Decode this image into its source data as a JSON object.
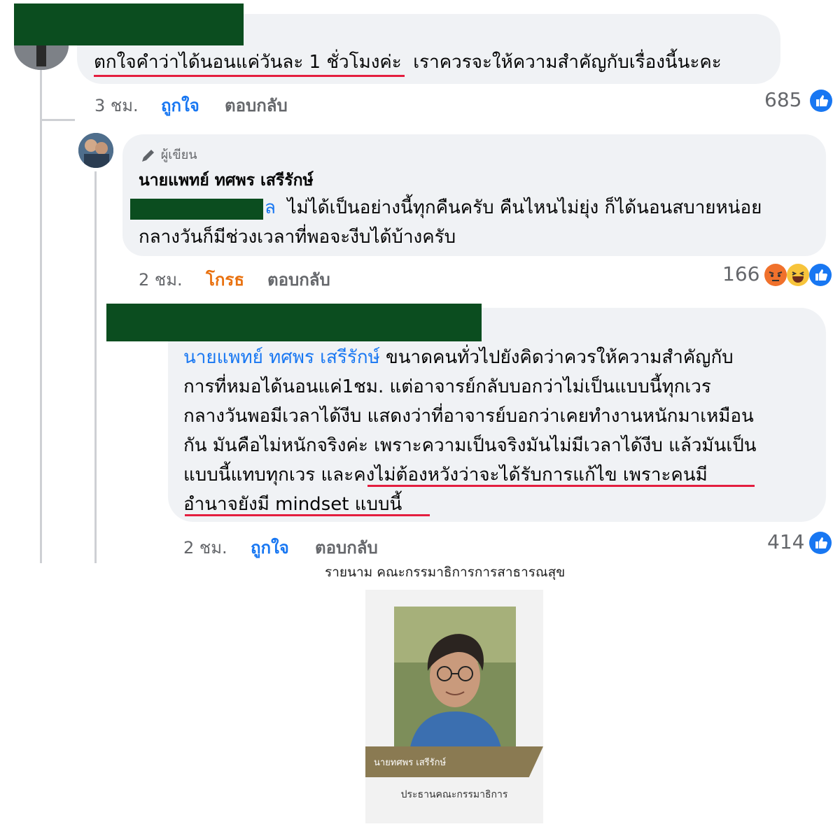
{
  "comment1": {
    "text_part1": "ตกใจคำว่าได้นอนแค่วันละ 1 ชั่วโมงค่ะ",
    "text_part2": "เราควรจะให้ความสำคัญกับเรื่องนี้นะคะ",
    "time": "3 ชม.",
    "reaction_label": "ถูกใจ",
    "reply_label": "ตอบกลับ",
    "count": "685",
    "reaction_icons": [
      "like-icon"
    ]
  },
  "reply1": {
    "badge": "ผู้เขียน",
    "author": "นายแพทย์ ทศพร เสรีรักษ์",
    "mention_tail": "ล",
    "line1": "ไม่ได้เป็นอย่างนี้ทุกคืนครับ คืนไหนไม่ยุ่ง ก็ได้นอนสบายหน่อย",
    "line2": "กลางวันก็มีช่วงเวลาที่พอจะงีบได้บ้างครับ",
    "time": "2 ชม.",
    "reaction_label": "โกรธ",
    "reply_label": "ตอบกลับ",
    "count": "166",
    "reaction_icons": [
      "angry-icon",
      "haha-icon",
      "like-icon"
    ]
  },
  "reply2": {
    "mention": "นายแพทย์ ทศพร เสรีรักษ์",
    "line1": "ขนาดคนทั่วไปยังคิดว่าควรให้ความสำคัญกับ",
    "line2": "การที่หมอได้นอนแค่1ชม. แต่อาจารย์กลับบอกว่าไม่เป็นแบบนี้ทุกเวร",
    "line3": "กลางวันพอมีเวลาได้งีบ แสดงว่าที่อาจารย์บอกว่าเคยทำงานหนักมาเหมือน",
    "line4": "กัน มันคือไม่หนักจริงค่ะ เพราะความเป็นจริงมันไม่มีเวลาได้งีบ แล้วมันเป็น",
    "line5": "แบบนี้แทบทุกเวร และคงไม่ต้องหวังว่าจะได้รับการแก้ไข เพราะคนมี",
    "line6": "อำนาจยังมี mindset แบบนี้",
    "time": "2 ชม.",
    "reaction_label": "ถูกใจ",
    "reply_label": "ตอบกลับ",
    "count": "414",
    "reaction_icons": [
      "like-icon"
    ]
  },
  "board": {
    "heading": "รายนาม คณะกรรมาธิการการสาธารณสุข",
    "person_name": "นายทศพร เสรีรักษ์",
    "person_title": "ประธานคณะกรรมาธิการ"
  },
  "colors": {
    "redaction": "#0b4d1f",
    "like_blue": "#1877f2",
    "angry_orange": "#e9710f",
    "underline_red": "#e41e3f",
    "bubble_gray": "#f0f2f5",
    "gold_band": "#8a7a52"
  }
}
